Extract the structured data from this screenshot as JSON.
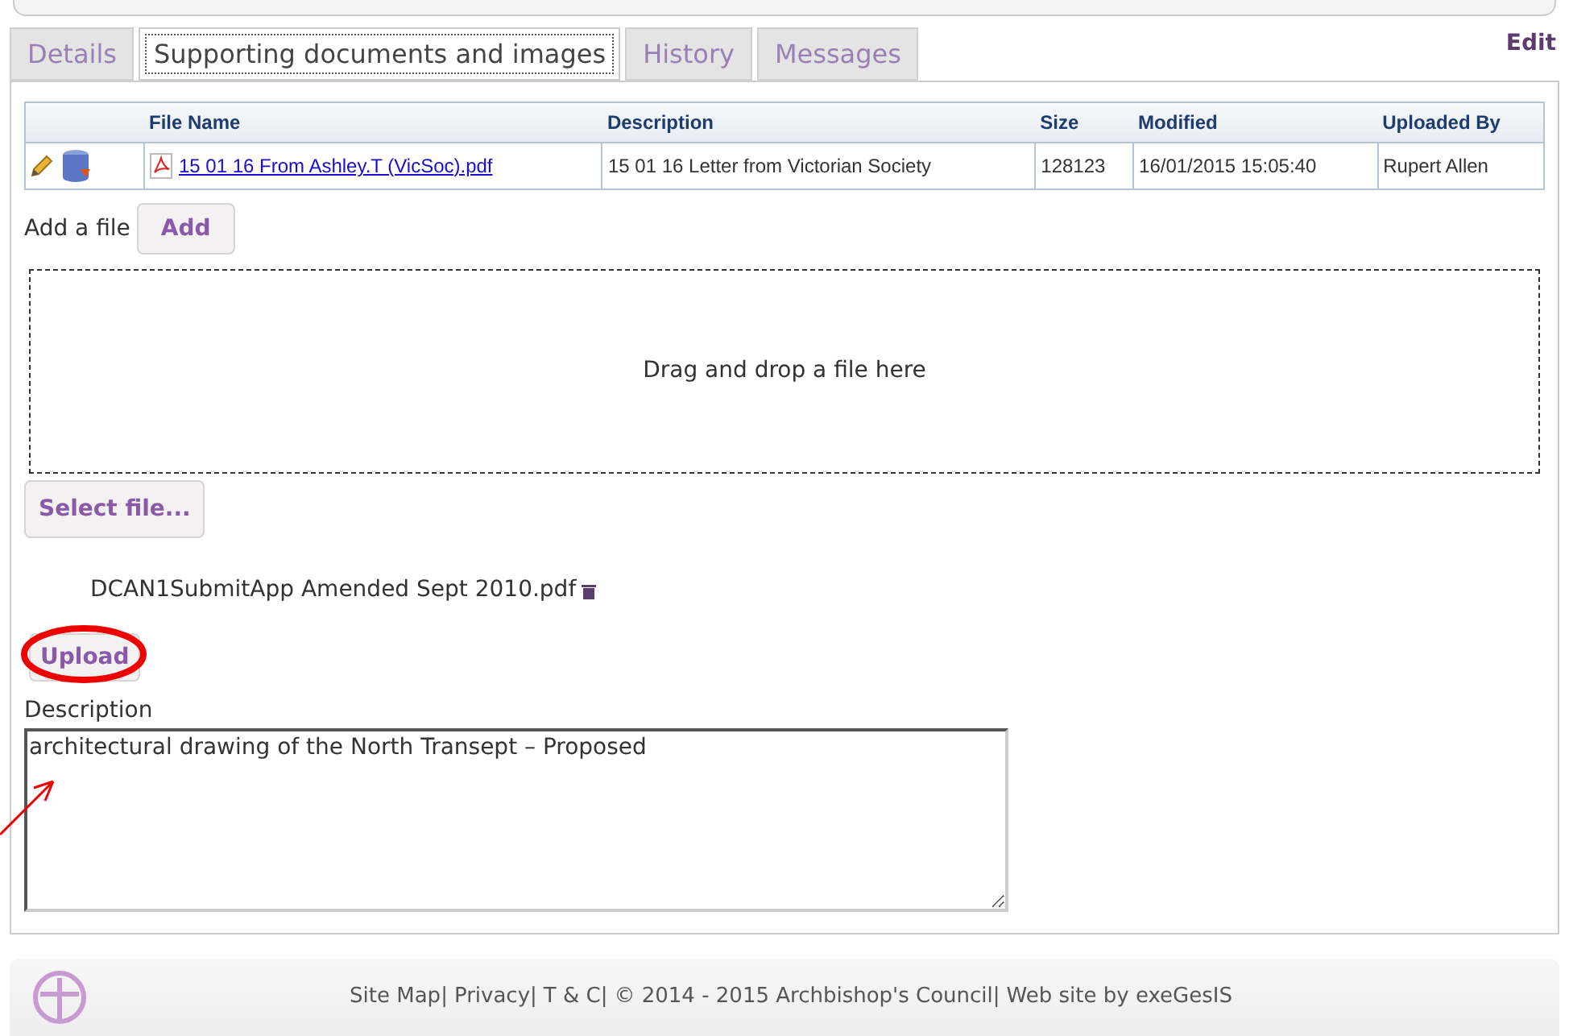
{
  "tabs": [
    {
      "label": "Details",
      "selected": false
    },
    {
      "label": "Supporting documents and images",
      "selected": true
    },
    {
      "label": "History",
      "selected": false
    },
    {
      "label": "Messages",
      "selected": false
    }
  ],
  "edit_link": "Edit",
  "table": {
    "columns": [
      "File Name",
      "Description",
      "Size",
      "Modified",
      "Uploaded By"
    ],
    "rows": [
      {
        "file_name": "15 01 16 From Ashley.T (VicSoc).pdf",
        "description": "15 01 16 Letter from Victorian Society",
        "size": "128123",
        "modified": "16/01/2015 15:05:40",
        "uploaded_by": "Rupert Allen"
      }
    ]
  },
  "add_file": {
    "label": "Add a file",
    "button": "Add"
  },
  "drop_zone": "Drag and drop a file here",
  "select_button": "Select file...",
  "selected_file": "DCAN1SubmitApp Amended Sept 2010.pdf",
  "upload_button": "Upload",
  "description": {
    "label": "Description",
    "value": "architectural drawing of the North Transept – Proposed"
  },
  "footer": {
    "separator": "|",
    "items": [
      "Site Map",
      "Privacy",
      "T & C",
      "© 2014 - 2015 Archbishop's Council",
      "Web site by exeGesIS"
    ]
  }
}
